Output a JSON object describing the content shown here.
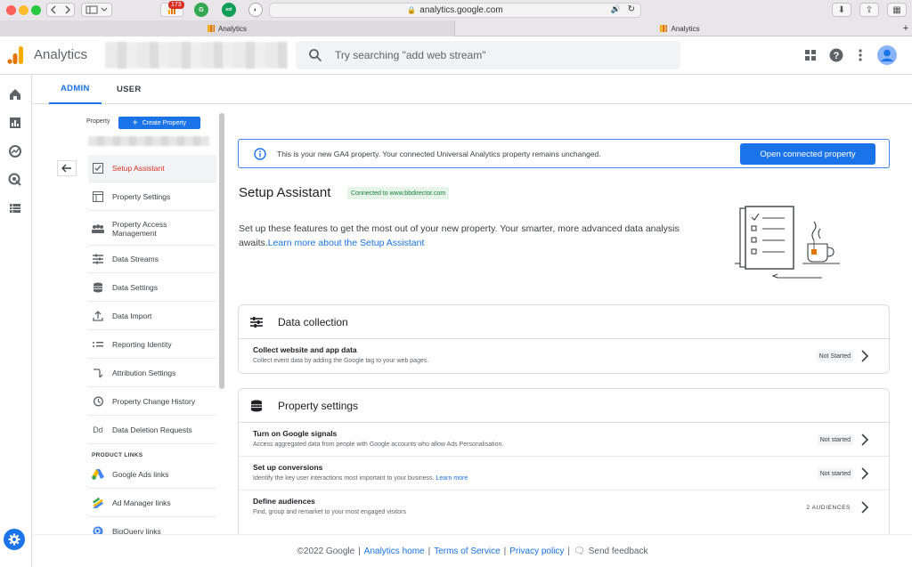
{
  "browser": {
    "url": "analytics.google.com",
    "tabs": [
      {
        "title": "Analytics"
      },
      {
        "title": "Analytics"
      }
    ],
    "badge_count": "173"
  },
  "header": {
    "app_name": "Analytics",
    "search_placeholder": "Try searching \"add web stream\""
  },
  "admin_tabs": [
    "ADMIN",
    "USER"
  ],
  "nav": {
    "property_label": "Property",
    "create_property": "Create Property",
    "items": [
      {
        "label": "Setup Assistant",
        "icon": "checkbox-icon"
      },
      {
        "label": "Property Settings",
        "icon": "settings-page-icon"
      },
      {
        "label": "Property Access Management",
        "icon": "people-icon"
      },
      {
        "label": "Data Streams",
        "icon": "streams-icon"
      },
      {
        "label": "Data Settings",
        "icon": "database-icon"
      },
      {
        "label": "Data Import",
        "icon": "upload-icon"
      },
      {
        "label": "Reporting Identity",
        "icon": "identity-icon"
      },
      {
        "label": "Attribution Settings",
        "icon": "attribution-icon"
      },
      {
        "label": "Property Change History",
        "icon": "history-icon"
      },
      {
        "label": "Data Deletion Requests",
        "icon": "dd-icon"
      }
    ],
    "product_links_label": "PRODUCT LINKS",
    "links": [
      {
        "label": "Google Ads links",
        "icon": "google-ads-icon"
      },
      {
        "label": "Ad Manager links",
        "icon": "ad-manager-icon"
      },
      {
        "label": "BigQuery links",
        "icon": "bigquery-icon"
      }
    ]
  },
  "banner": {
    "message": "This is your new GA4 property. Your connected Universal Analytics property remains unchanged.",
    "button": "Open connected property"
  },
  "setup": {
    "title": "Setup Assistant",
    "connected": "Connected to www.bbdirector.com",
    "intro": "Set up these features to get the most out of your new property. Your smarter, more advanced data analysis awaits.",
    "intro_link": "Learn more about the Setup Assistant"
  },
  "cards": [
    {
      "title": "Data collection",
      "rows": [
        {
          "title": "Collect website and app data",
          "desc": "Collect event data by adding the Google tag to your web pages.",
          "status": "Not Started"
        }
      ]
    },
    {
      "title": "Property settings",
      "rows": [
        {
          "title": "Turn on Google signals",
          "desc": "Access aggregated data from people with Google accounts who allow Ads Personalisation.",
          "status": "Not started"
        },
        {
          "title": "Set up conversions",
          "desc": "Identify the key user interactions most important to your business.",
          "desc_link": "Learn more",
          "status": "Not started"
        },
        {
          "title": "Define audiences",
          "desc": "Find, group and remarket to your most engaged visitors",
          "status": "2 AUDIENCES"
        }
      ]
    }
  ],
  "footer": {
    "copyright": "©2022 Google",
    "sep": "|",
    "links": [
      "Analytics home",
      "Terms of Service",
      "Privacy policy"
    ],
    "feedback": "Send feedback"
  },
  "colors": {
    "accent": "#1a73e8",
    "active_red": "#d93025",
    "connected_green": "#188038"
  }
}
